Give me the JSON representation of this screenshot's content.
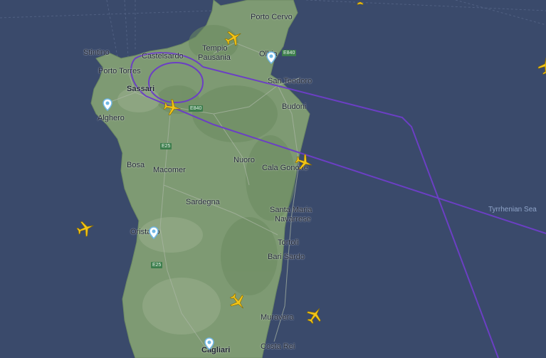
{
  "map": {
    "colors": {
      "sea": "#3a4a6b",
      "land": "#7e9a73",
      "route": "#6b3fc4",
      "plane": "#f2c418",
      "pin": "#6fb7e6",
      "shield": "#3c7d4c"
    },
    "places": {
      "porto_cervo": "Porto Cervo",
      "stintino": "Stintino",
      "castelsardo": "Castelsardo",
      "tempio": "Tempio",
      "pausania": "Pausania",
      "olbia": "Olbia",
      "porto_torres": "Porto Torres",
      "sassari": "Sassari",
      "san_teodoro": "San Teodoro",
      "budoni": "Budoni",
      "alghero": "Alghero",
      "bosa": "Bosa",
      "macomer": "Macomer",
      "nuoro": "Nuoro",
      "cala_gonone": "Cala Gonone",
      "sardegna": "Sardegna",
      "santa_maria": "Santa Maria",
      "navarrese": "Navarrese",
      "oristano": "Oristano",
      "tortoli": "Tortolì",
      "bari_sardo": "Bari Sardo",
      "muravera": "Muravera",
      "cagliari": "Cagliari",
      "costa_rei": "Costa Rei",
      "tyrrhenian_sea": "Tyrrhenian Sea"
    },
    "road_shields": {
      "e840_a": "E840",
      "e840_b": "E840",
      "e25_a": "E25",
      "e25_b": "E25"
    },
    "icons": {
      "plane": "airplane-icon",
      "pin": "map-pin-icon"
    }
  }
}
